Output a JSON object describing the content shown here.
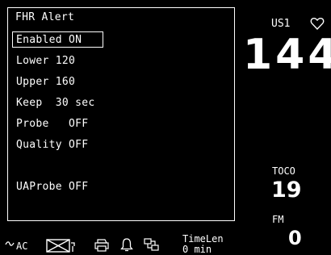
{
  "menu": {
    "title": "FHR Alert",
    "items": [
      {
        "label": "Enabled ON"
      },
      {
        "label": "Lower 120"
      },
      {
        "label": "Upper 160"
      },
      {
        "label": "Keep  30 sec"
      },
      {
        "label": "Probe   OFF"
      },
      {
        "label": "Quality OFF"
      },
      {
        "label": "UAProbe OFF"
      }
    ]
  },
  "vitals": {
    "us_label": "US1",
    "fhr_value": "144",
    "toco_label": "TOCO",
    "toco_value": "19",
    "fm_label": "FM",
    "fm_value": "0"
  },
  "status": {
    "ac_label": "AC",
    "timelen_label": "TimeLen",
    "timelen_value": "0 min",
    "icons": [
      "ac-power-icon",
      "no-paper-icon",
      "printer-icon",
      "bell-icon",
      "network-icon",
      "heart-icon"
    ]
  }
}
